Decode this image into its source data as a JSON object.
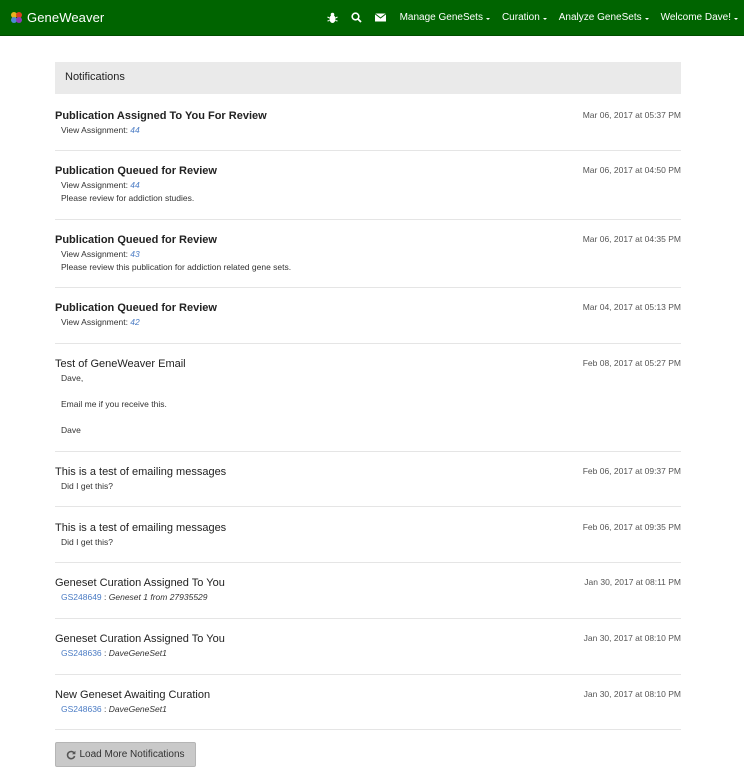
{
  "app": {
    "brand": "GeneWeaver",
    "colors": {
      "navbar": "#006400",
      "header_bar": "#eaeaea",
      "link": "#4a7bc4",
      "button": "#c9c9c9"
    }
  },
  "nav": {
    "icons": [
      "bug-icon",
      "search-icon",
      "envelope-icon"
    ],
    "items": [
      "Manage GeneSets",
      "Curation",
      "Analyze GeneSets",
      "Welcome Dave!"
    ]
  },
  "page": {
    "header": "Notifications"
  },
  "notifications": [
    {
      "title": "Publication Assigned To You For Review",
      "date": "Mar 06, 2017 at 05:37 PM",
      "line1_label": "View Assignment: ",
      "line1_link": "44"
    },
    {
      "title": "Publication Queued for Review",
      "date": "Mar 06, 2017 at 04:50 PM",
      "line1_label": "View Assignment: ",
      "line1_link": "44",
      "line2": "Please review for addiction studies."
    },
    {
      "title": "Publication Queued for Review",
      "date": "Mar 06, 2017 at 04:35 PM",
      "line1_label": "View Assignment: ",
      "line1_link": "43",
      "line2": "Please review this publication for addiction related gene sets."
    },
    {
      "title": "Publication Queued for Review",
      "date": "Mar 04, 2017 at 05:13 PM",
      "line1_label": "View Assignment: ",
      "line1_link": "42"
    },
    {
      "title": "Test of GeneWeaver Email",
      "date": "Feb 08, 2017 at 05:27 PM",
      "body": [
        "Dave,",
        "Email me if you receive this.",
        "Dave"
      ]
    },
    {
      "title": "This is a test of emailing messages",
      "date": "Feb 06, 2017 at 09:37 PM",
      "body": [
        "Did I get this?"
      ]
    },
    {
      "title": "This is a test of emailing messages",
      "date": "Feb 06, 2017 at 09:35 PM",
      "body": [
        "Did I get this?"
      ]
    },
    {
      "title": "Geneset Curation Assigned To You",
      "date": "Jan 30, 2017 at 08:11 PM",
      "gs_id": "GS248649",
      "sep": " : ",
      "gs_name": "Geneset 1 from 27935529"
    },
    {
      "title": "Geneset Curation Assigned To You",
      "date": "Jan 30, 2017 at 08:10 PM",
      "gs_id": "GS248636",
      "sep": " : ",
      "gs_name": "DaveGeneSet1"
    },
    {
      "title": "New Geneset Awaiting Curation",
      "date": "Jan 30, 2017 at 08:10 PM",
      "gs_id": "GS248636",
      "sep": " : ",
      "gs_name": "DaveGeneSet1"
    }
  ],
  "load_more": "Load More Notifications"
}
